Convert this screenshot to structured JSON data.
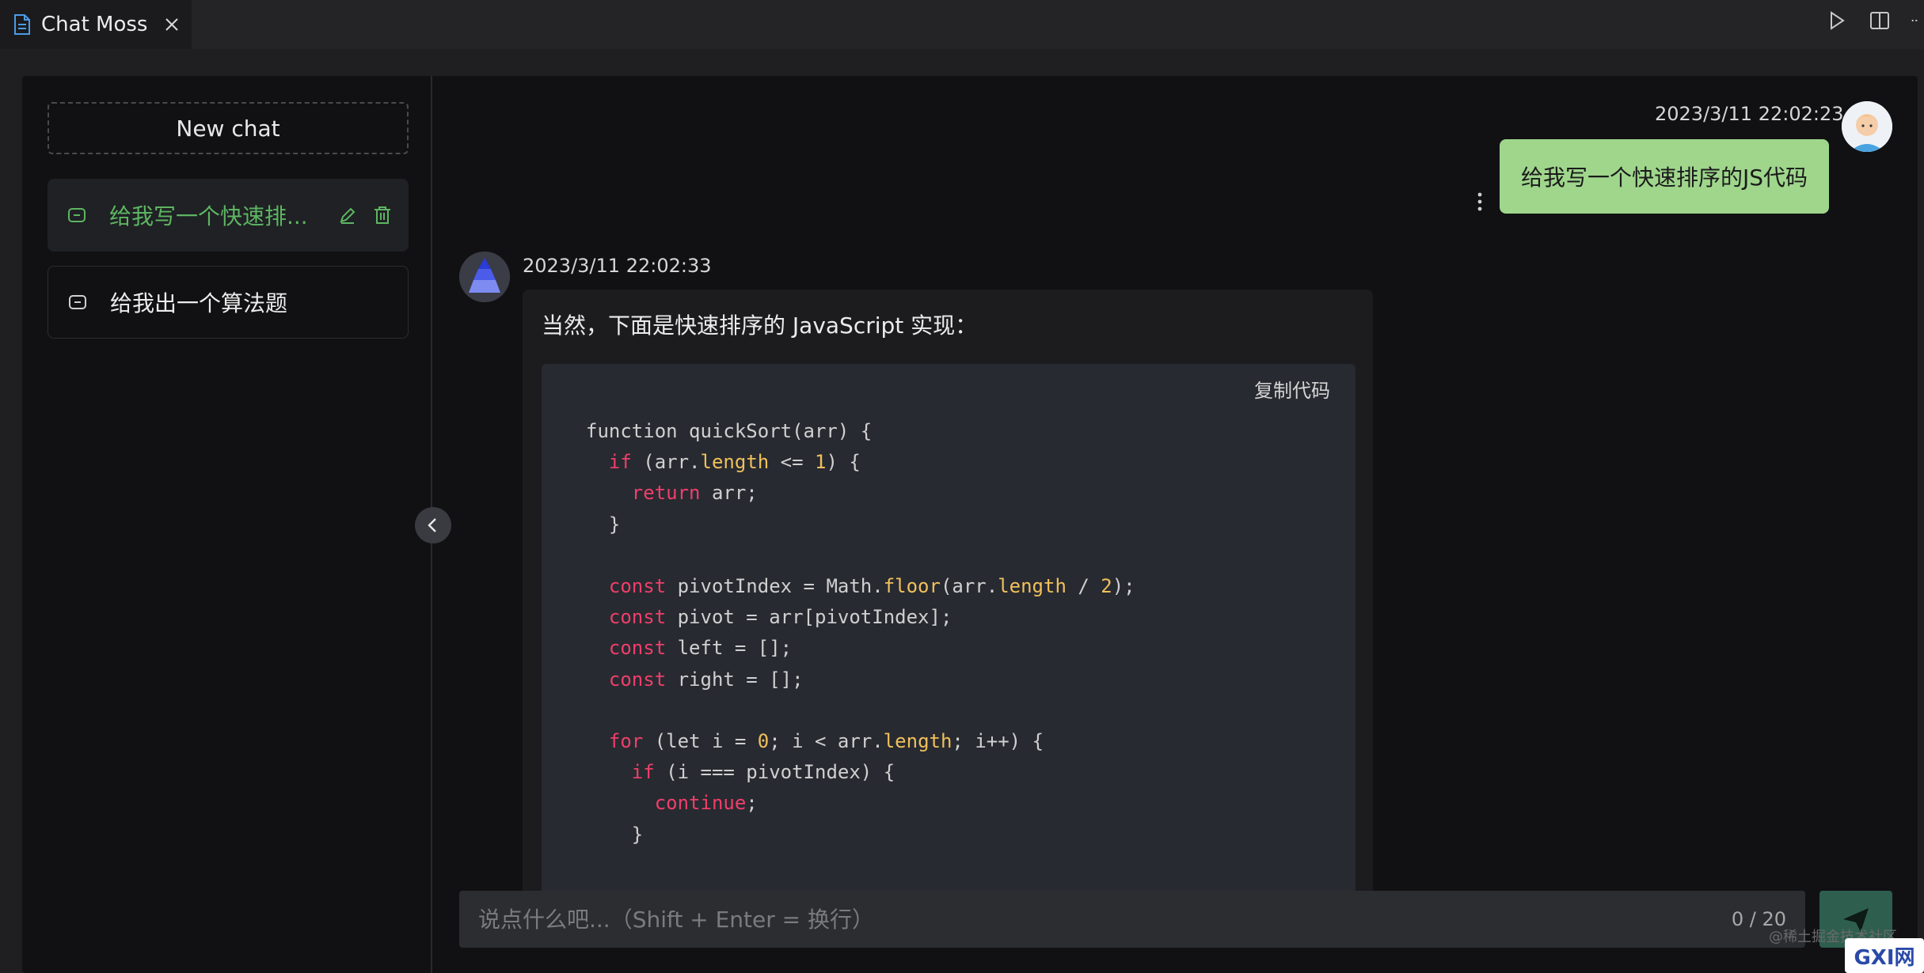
{
  "tab": {
    "title": "Chat Moss"
  },
  "sidebar": {
    "new_chat_label": "New chat",
    "conversations": [
      {
        "label": "给我写一个快速排...",
        "active": true
      },
      {
        "label": "给我出一个算法题",
        "active": false
      }
    ]
  },
  "chat": {
    "user_message": {
      "timestamp": "2023/3/11 22:02:23",
      "text": "给我写一个快速排序的JS代码"
    },
    "bot_message": {
      "timestamp": "2023/3/11 22:02:33",
      "intro": "当然，下面是快速排序的 JavaScript 实现：",
      "copy_label": "复制代码",
      "code_lines": [
        "function quickSort(arr) {",
        "  if (arr.length <= 1) {",
        "    return arr;",
        "  }",
        "",
        "  const pivotIndex = Math.floor(arr.length / 2);",
        "  const pivot = arr[pivotIndex];",
        "  const left = [];",
        "  const right = [];",
        "",
        "  for (let i = 0; i < arr.length; i++) {",
        "    if (i === pivotIndex) {",
        "      continue;",
        "    }"
      ]
    }
  },
  "input": {
    "placeholder": "说点什么吧...（Shift + Enter = 换行）",
    "value": "",
    "char_count": "0 / 20"
  },
  "watermark": "@稀土掘金技术社区",
  "logo": "GXI网",
  "colors": {
    "accent_green": "#5db562",
    "user_bubble": "#9fd68c",
    "keyword": "#ef3f6a",
    "property": "#f0c05b",
    "send_button": "#2e5e4e"
  }
}
